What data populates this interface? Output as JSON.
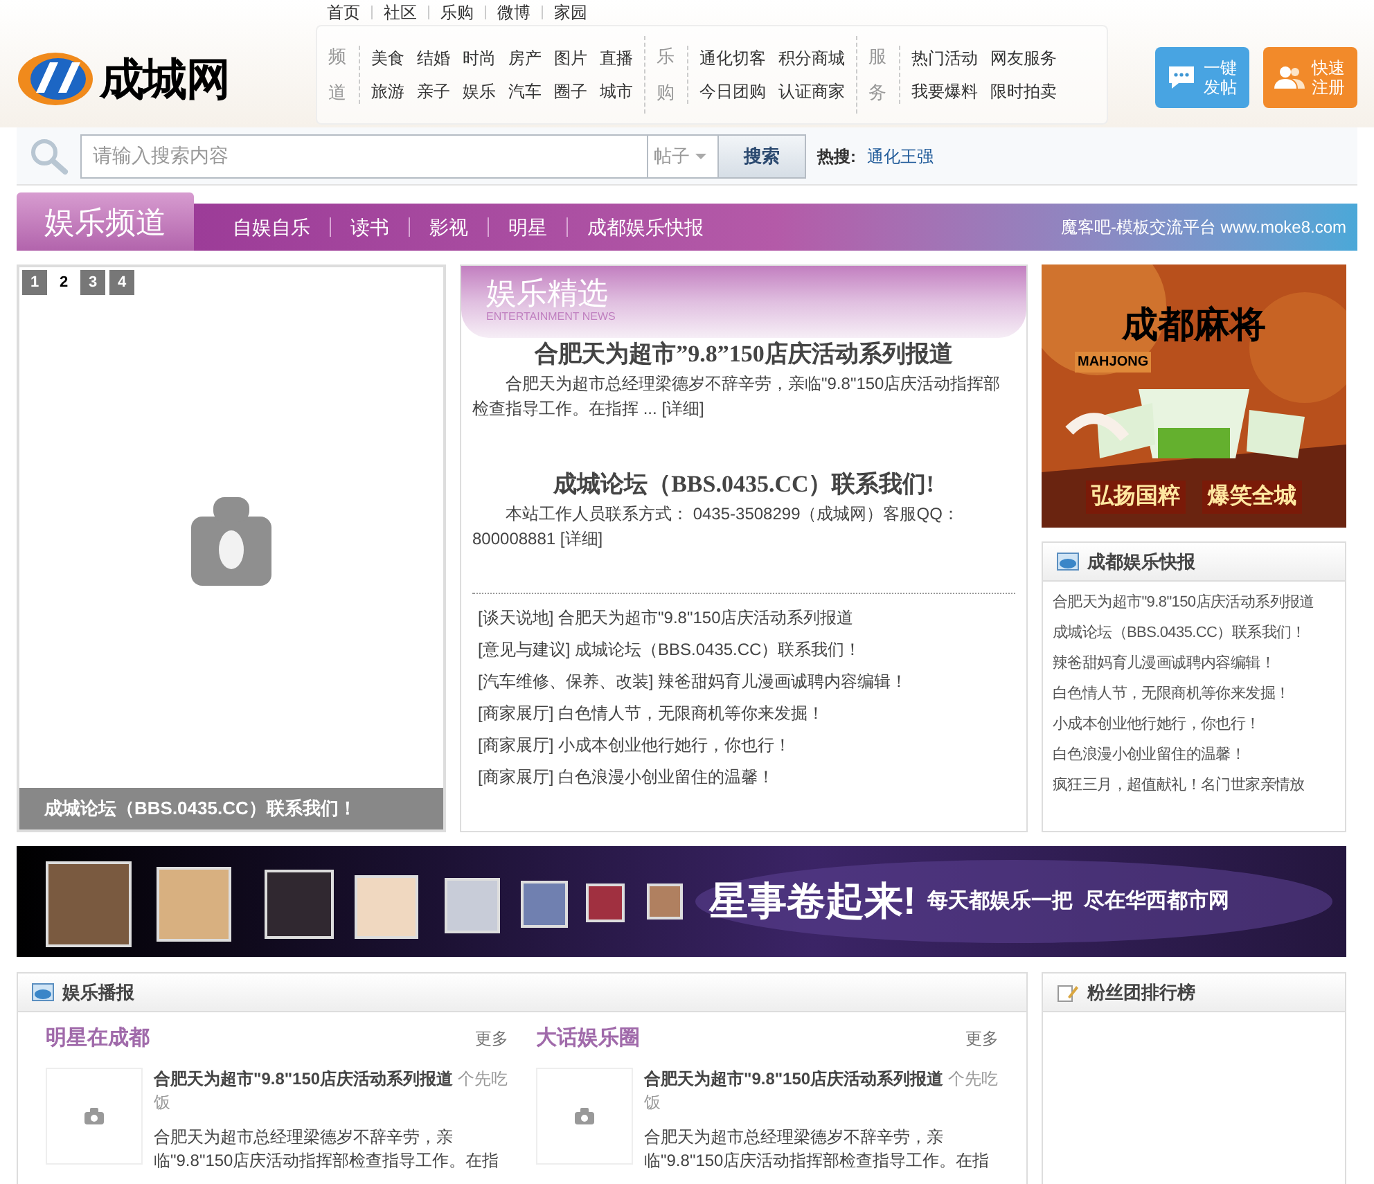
{
  "top_nav": [
    "首页",
    "社区",
    "乐购",
    "微博",
    "家园"
  ],
  "logo": {
    "text": "成城网"
  },
  "nav_groups": [
    {
      "label": "频道",
      "links": [
        [
          "美食",
          "结婚",
          "时尚",
          "房产",
          "图片",
          "直播"
        ],
        [
          "旅游",
          "亲子",
          "娱乐",
          "汽车",
          "圈子",
          "城市"
        ]
      ]
    },
    {
      "label": "乐购",
      "links": [
        [
          "通化切客",
          "积分商城"
        ],
        [
          "今日团购",
          "认证商家"
        ]
      ]
    },
    {
      "label": "服务",
      "links": [
        [
          "热门活动",
          "网友服务"
        ],
        [
          "我要爆料",
          "限时拍卖"
        ]
      ]
    }
  ],
  "header_buttons": [
    {
      "kind": "post",
      "label": "一键发帖"
    },
    {
      "kind": "register",
      "label": "快速注册"
    }
  ],
  "search": {
    "placeholder": "请输入搜索内容",
    "scope": "帖子",
    "button": "搜索",
    "hot_label": "热搜:",
    "hot_links": [
      "通化王强"
    ]
  },
  "channel": {
    "title": "娱乐频道",
    "links": [
      "自娱自乐",
      "读书",
      "影视",
      "明星",
      "成都娱乐快报"
    ],
    "site_note": "魔客吧-模板交流平台 www.moke8.com"
  },
  "slideshow": {
    "pages": [
      {
        "label": "1",
        "selected": false
      },
      {
        "label": "2",
        "selected": true
      },
      {
        "label": "3",
        "selected": false
      },
      {
        "label": "4",
        "selected": false
      }
    ],
    "caption": "成城论坛（BBS.0435.CC）联系我们！"
  },
  "featured": {
    "title": "娱乐精选",
    "subtitle": "ENTERTAINMENT NEWS",
    "stories": [
      {
        "headline": "合肥天为超市”9.8”150店庆活动系列报道",
        "summary": "合肥天为超市总经理梁德岁不辞辛劳，亲临\"9.8\"150店庆活动指挥部检查指导工作。在指挥 ...",
        "more": "[详细]"
      },
      {
        "headline": "成城论坛（BBS.0435.CC）联系我们!",
        "summary": "本站工作人员联系方式： 0435-3508299（成城网）客服QQ：800008881",
        "more": "[详细]"
      }
    ],
    "list": [
      {
        "category": "[谈天说地]",
        "title": "合肥天为超市\"9.8\"150店庆活动系列报道"
      },
      {
        "category": "[意见与建议]",
        "title": "成城论坛（BBS.0435.CC）联系我们！"
      },
      {
        "category": "[汽车维修、保养、改装]",
        "title": "辣爸甜妈育儿漫画诚聘内容编辑！"
      },
      {
        "category": "[商家展厅]",
        "title": "白色情人节，无限商机等你来发掘！"
      },
      {
        "category": "[商家展厅]",
        "title": "小成本创业他行她行，你也行！"
      },
      {
        "category": "[商家展厅]",
        "title": "白色浪漫小创业留住的温馨！"
      }
    ]
  },
  "ad": {
    "kind": "picture",
    "texts": [
      "成都麻将",
      "MAHJONG",
      "弘扬国粹",
      "爆笑全城"
    ]
  },
  "quick_news": {
    "title": "成都娱乐快报",
    "items": [
      "合肥天为超市\"9.8\"150店庆活动系列报道",
      "成城论坛（BBS.0435.CC）联系我们！",
      "辣爸甜妈育儿漫画诚聘内容编辑！",
      "白色情人节，无限商机等你来发掘！",
      "小成本创业他行她行，你也行！",
      "白色浪漫小创业留住的温馨！",
      "疯狂三月，超值献礼！名门世家亲情放"
    ]
  },
  "star_banner": {
    "kind": "picture",
    "slogan": "星事卷起来!",
    "tagline": "每天都娱乐一把  尽在华西都市网"
  },
  "broadcast": {
    "title": "娱乐播报",
    "columns": [
      {
        "title": "明星在成都",
        "more": "更多",
        "headline": "合肥天为超市\"9.8\"150店庆活动系列报道",
        "author": "个先吃饭",
        "summary": "合肥天为超市总经理梁德岁不辞辛劳，亲临\"9.8\"150店庆活动指挥部检查指导工作。在指"
      },
      {
        "title": "大话娱乐圈",
        "more": "更多",
        "headline": "合肥天为超市\"9.8\"150店庆活动系列报道",
        "author": "个先吃饭",
        "summary": "合肥天为超市总经理梁德岁不辞辛劳，亲临\"9.8\"150店庆活动指挥部检查指导工作。在指"
      }
    ]
  },
  "fans": {
    "title": "粉丝团排行榜"
  }
}
